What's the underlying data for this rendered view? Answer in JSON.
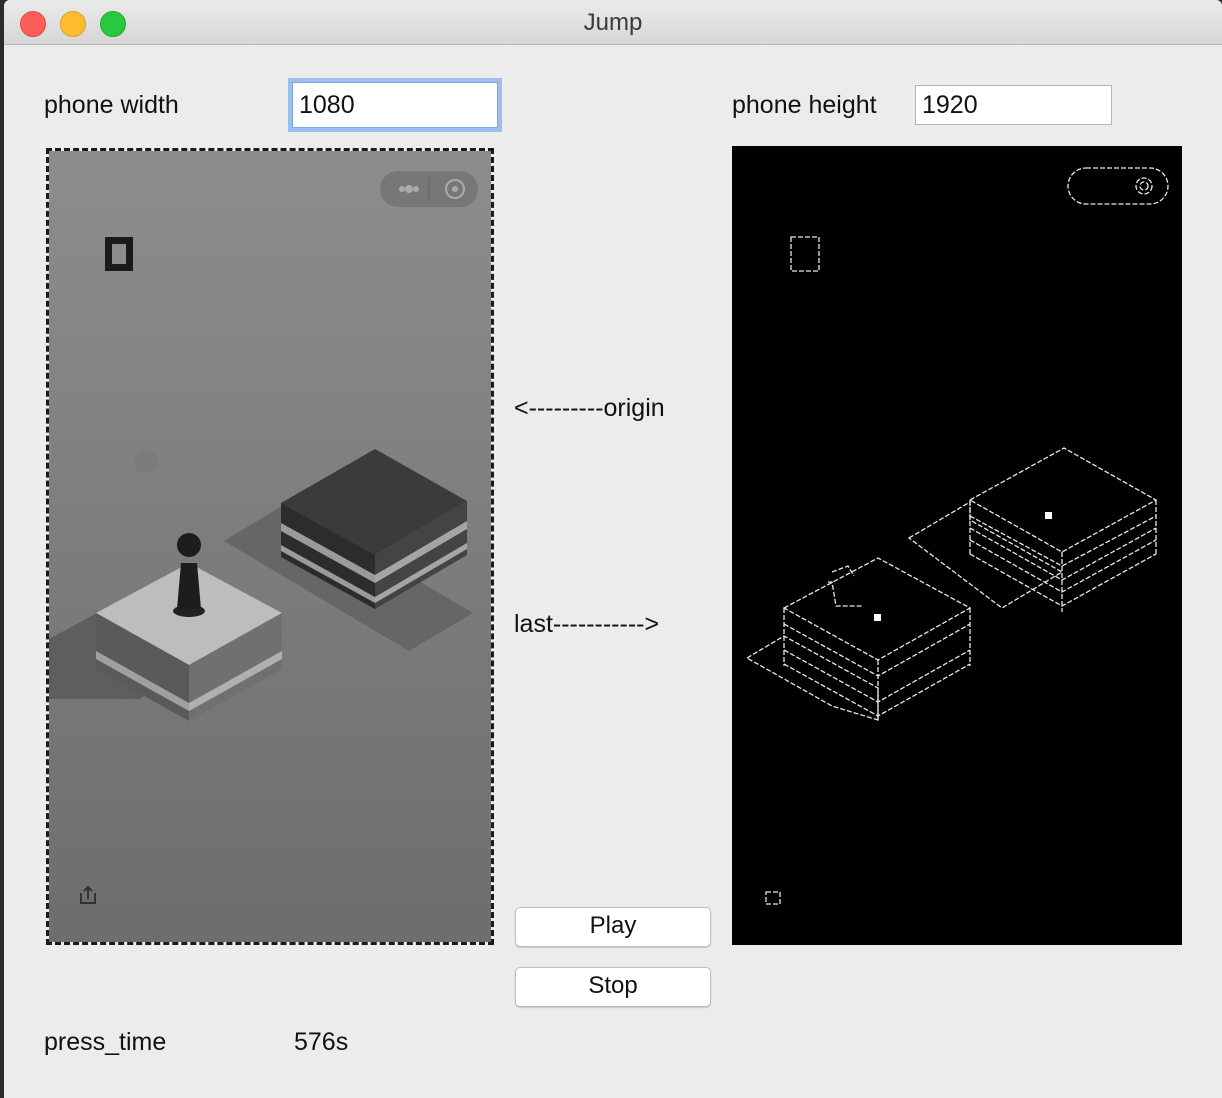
{
  "window": {
    "title": "Jump"
  },
  "form": {
    "phone_width_label": "phone width",
    "phone_width_value": "1080",
    "phone_height_label": "phone height",
    "phone_height_value": "1920"
  },
  "annotations": {
    "origin": "<---------origin",
    "last": "last----------->"
  },
  "buttons": {
    "play": "Play",
    "stop": "Stop"
  },
  "status": {
    "press_time_label": "press_time",
    "press_time_value": "576s"
  },
  "icons": [
    "close-traffic-light",
    "minimize-traffic-light",
    "zoom-traffic-light",
    "pause-icon",
    "more-icon",
    "target-icon",
    "share-icon"
  ]
}
